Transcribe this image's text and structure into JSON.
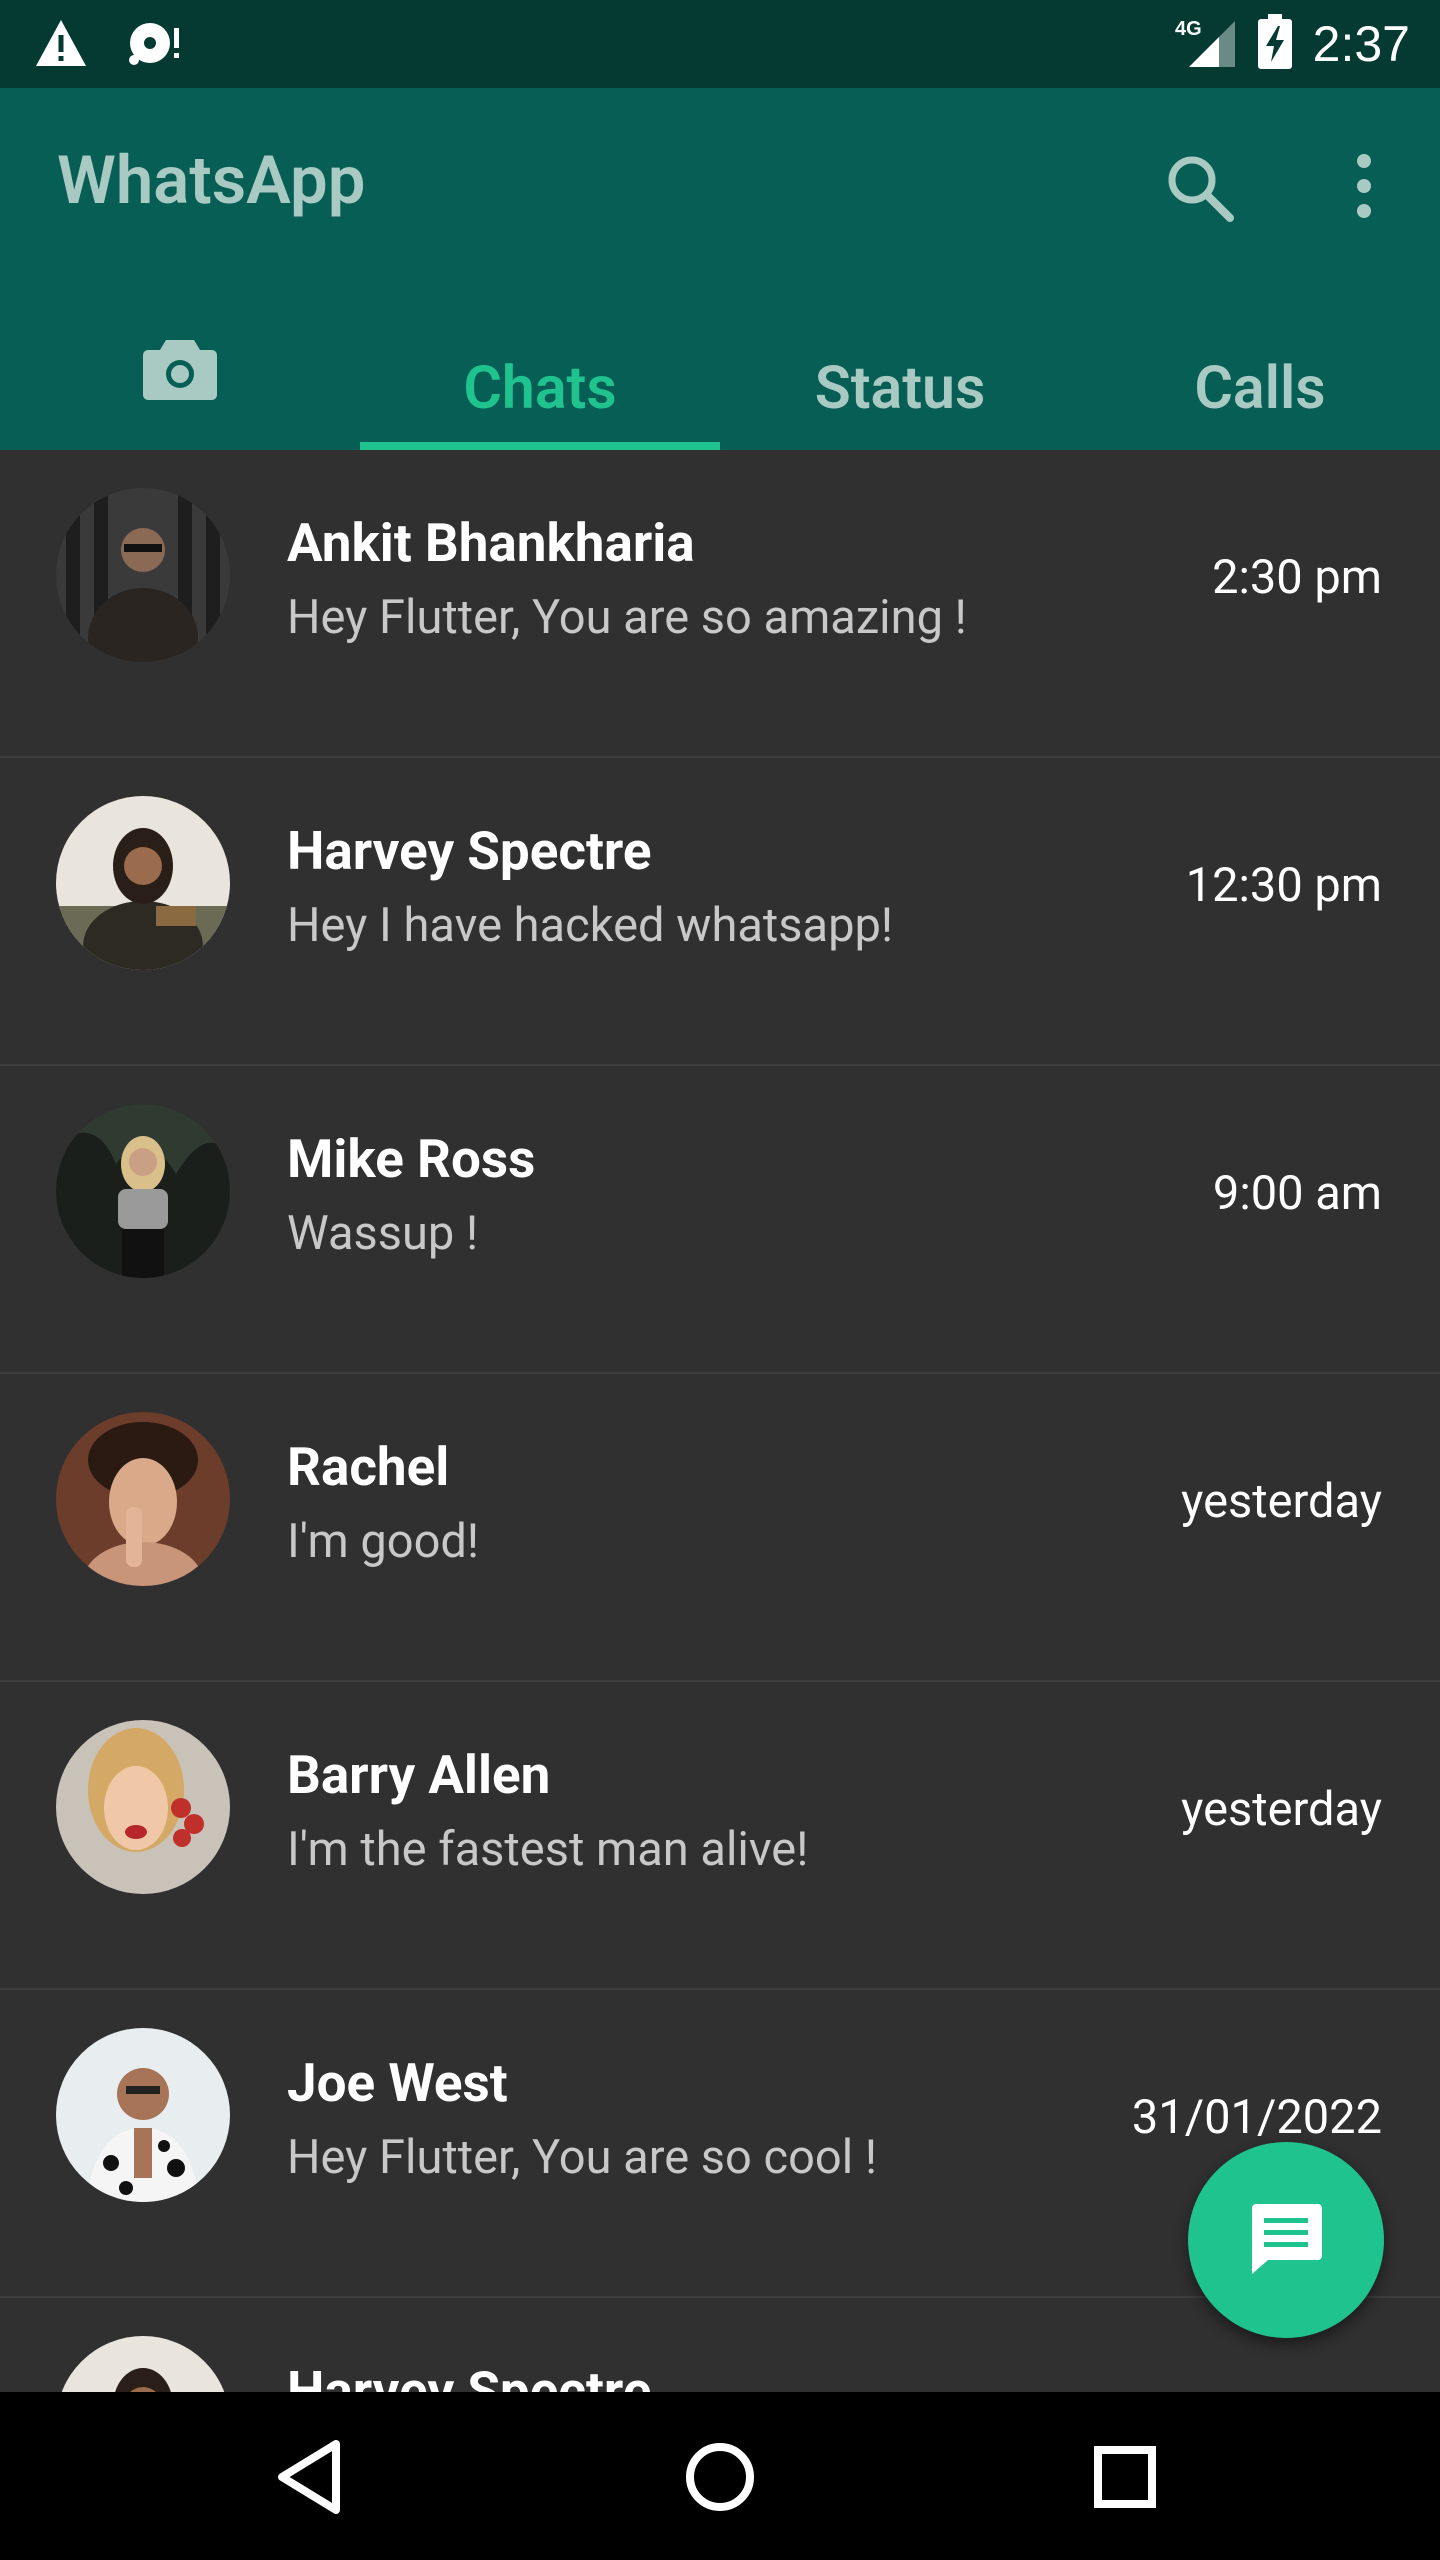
{
  "status_bar": {
    "time": "2:37",
    "network": "4G",
    "icons": [
      "warning-icon",
      "media-notification-icon",
      "signal-4g-icon",
      "battery-charging-icon"
    ]
  },
  "app": {
    "title": "WhatsApp",
    "actions": [
      "search-icon",
      "more-vert-icon"
    ]
  },
  "tabs": [
    {
      "icon": "camera-icon",
      "label": ""
    },
    {
      "label": "Chats",
      "active": true
    },
    {
      "label": "Status"
    },
    {
      "label": "Calls"
    }
  ],
  "chats": [
    {
      "name": "Ankit Bhankharia",
      "message": "Hey Flutter, You are so amazing !",
      "time": "2:30 pm"
    },
    {
      "name": "Harvey Spectre",
      "message": "Hey I have hacked whatsapp!",
      "time": "12:30 pm"
    },
    {
      "name": "Mike Ross",
      "message": "Wassup !",
      "time": "9:00 am"
    },
    {
      "name": "Rachel",
      "message": "I'm good!",
      "time": "yesterday"
    },
    {
      "name": "Barry Allen",
      "message": "I'm the fastest man alive!",
      "time": "yesterday"
    },
    {
      "name": "Joe West",
      "message": "Hey Flutter, You are so cool !",
      "time": "31/01/2022"
    },
    {
      "name": "Harvey Spectre",
      "message": "",
      "time": ""
    }
  ],
  "fab": {
    "icon": "chat-message-icon"
  },
  "navigation": {
    "icons": [
      "back-icon",
      "home-icon",
      "recents-icon"
    ]
  },
  "colors": {
    "status_bar": "#053a33",
    "app_bar": "#075e54",
    "accent": "#1fc38e",
    "background": "#303030",
    "inactive_tab": "#a9c9c3"
  }
}
